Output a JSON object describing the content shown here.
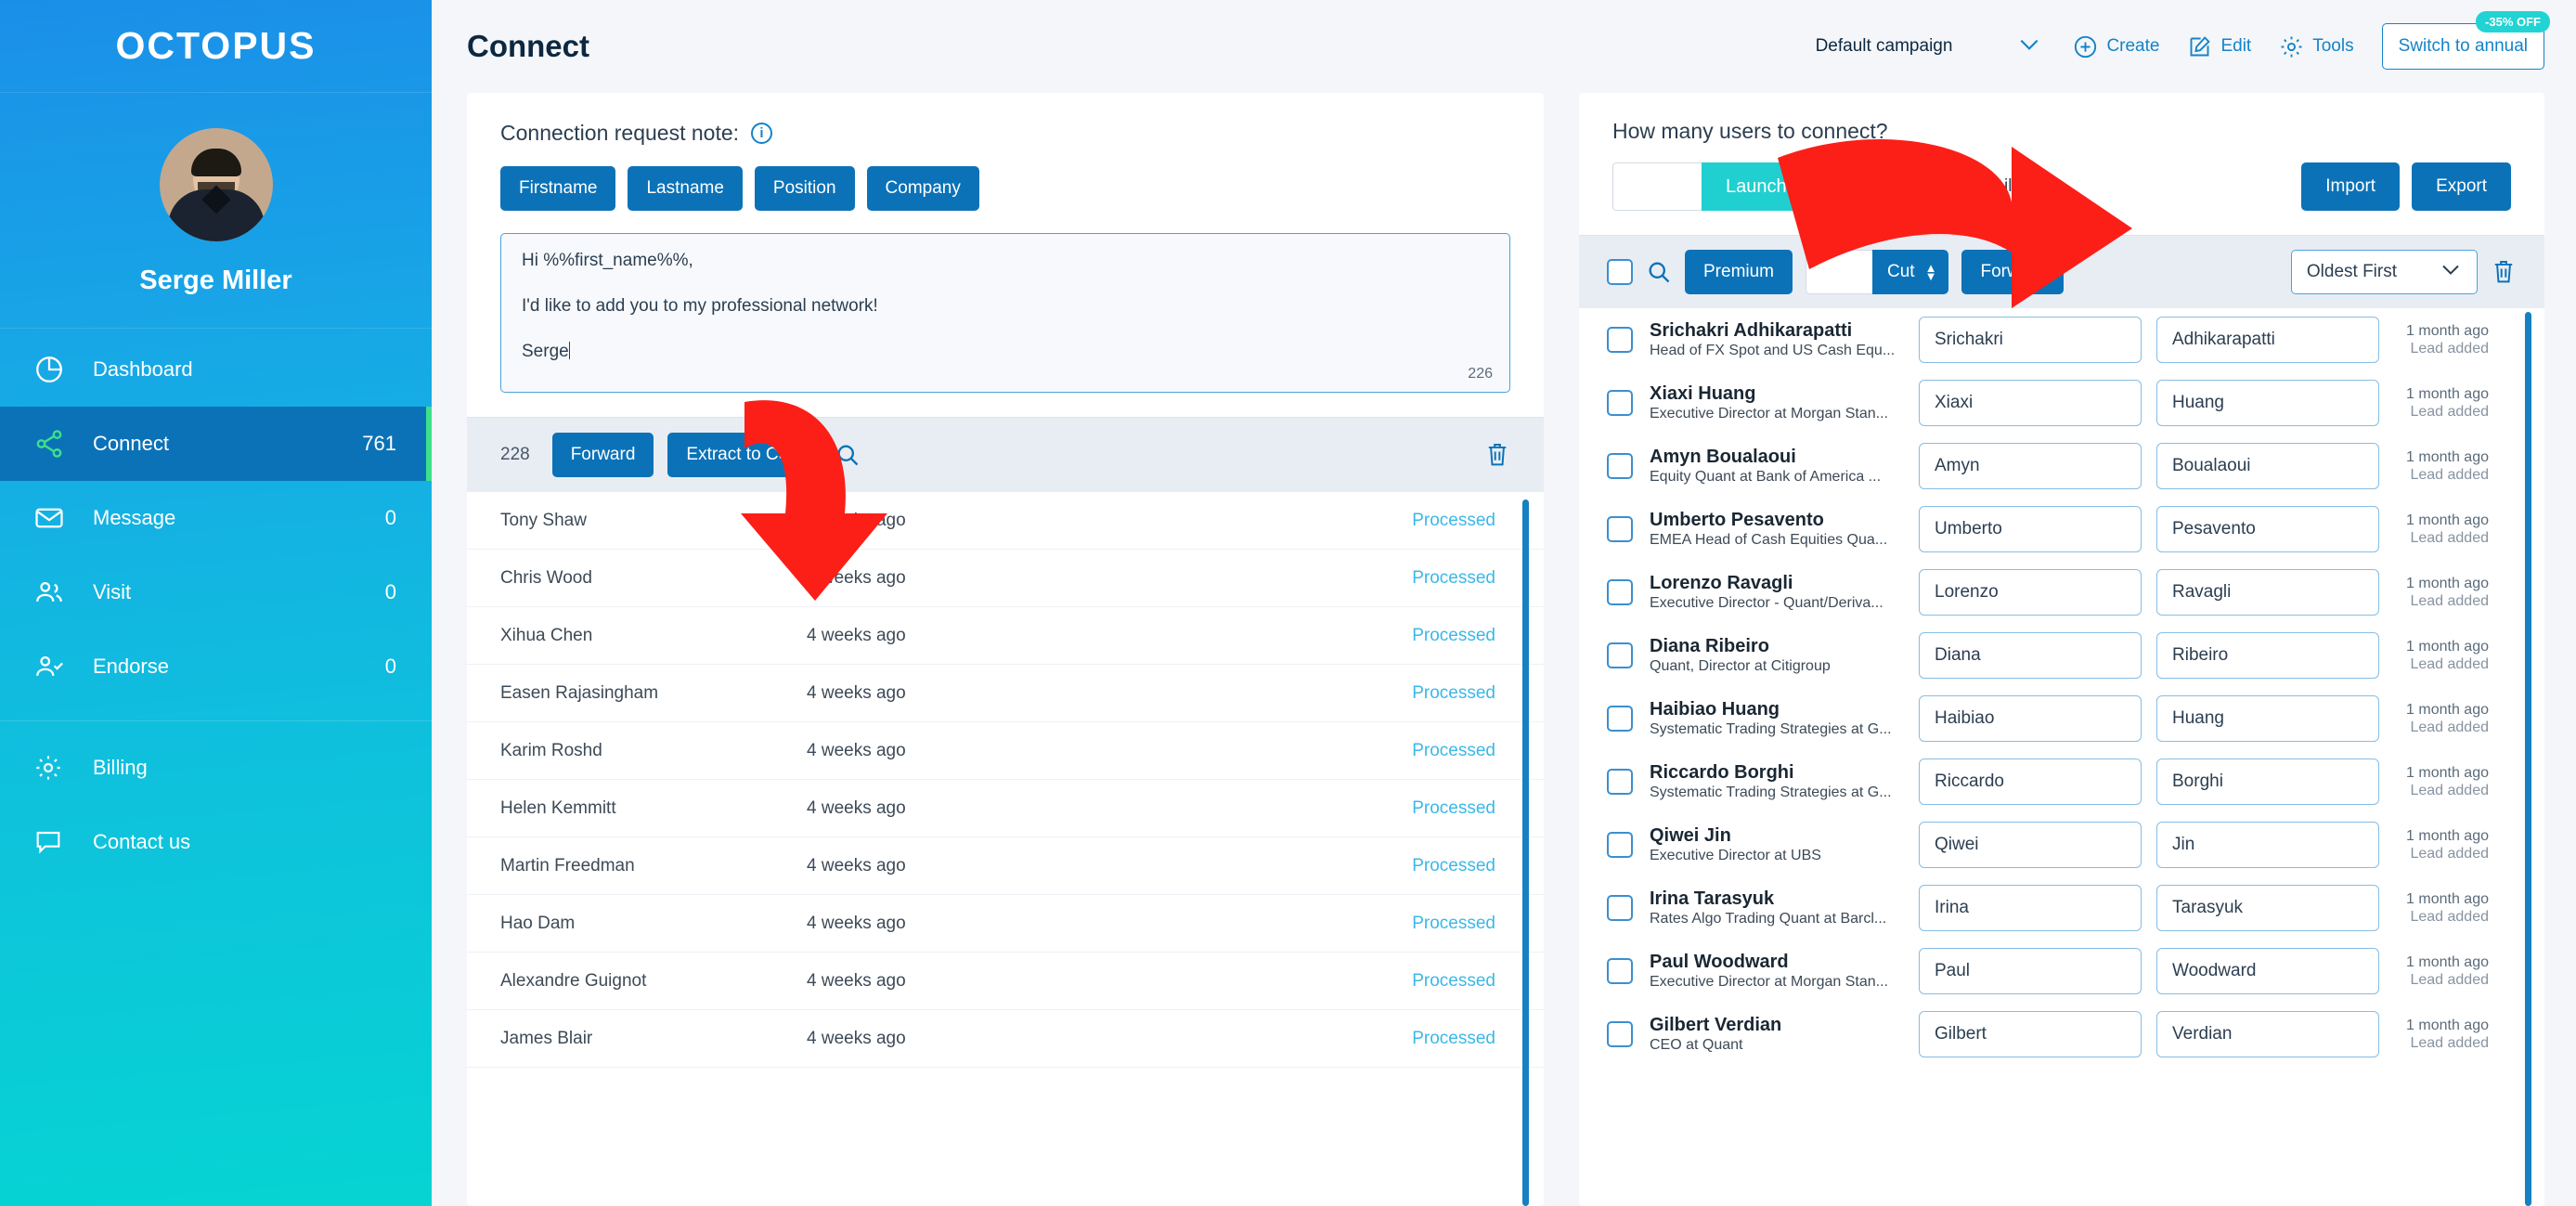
{
  "brand": {
    "logo_text": "OCTOPUS",
    "accent_blue": "#0b72b8",
    "accent_cyan": "#20cfcf",
    "green": "#3ee08a"
  },
  "sidebar": {
    "profile_name": "Serge Miller",
    "items": [
      {
        "label": "Dashboard",
        "count": "",
        "icon": "pie-chart-icon"
      },
      {
        "label": "Connect",
        "count": "761",
        "icon": "share-nodes-icon"
      },
      {
        "label": "Message",
        "count": "0",
        "icon": "envelope-icon"
      },
      {
        "label": "Visit",
        "count": "0",
        "icon": "users-icon"
      },
      {
        "label": "Endorse",
        "count": "0",
        "icon": "user-check-icon"
      }
    ],
    "bottom_items": [
      {
        "label": "Billing",
        "icon": "gear-icon"
      },
      {
        "label": "Contact us",
        "icon": "chat-bubble-icon"
      }
    ]
  },
  "header": {
    "title": "Connect",
    "campaign_value": "Default campaign",
    "create_label": "Create",
    "edit_label": "Edit",
    "tools_label": "Tools",
    "switch_annual_label": "Switch to annual",
    "discount_badge": "-35% OFF"
  },
  "note_panel": {
    "heading": "Connection request note:",
    "variables": [
      "Firstname",
      "Lastname",
      "Position",
      "Company"
    ],
    "message_lines": [
      "Hi %%first_name%%,",
      "I'd like to add you to my professional network!",
      "Serge"
    ],
    "char_count": "226"
  },
  "left_toolbar": {
    "count": "228",
    "forward_label": "Forward",
    "extract_label": "Extract to CSV"
  },
  "left_list": {
    "rows": [
      {
        "name": "Tony Shaw",
        "time": "4 weeks ago",
        "status": "Processed"
      },
      {
        "name": "Chris Wood",
        "time": "4 weeks ago",
        "status": "Processed"
      },
      {
        "name": "Xihua Chen",
        "time": "4 weeks ago",
        "status": "Processed"
      },
      {
        "name": "Easen Rajasingham",
        "time": "4 weeks ago",
        "status": "Processed"
      },
      {
        "name": "Karim Roshd",
        "time": "4 weeks ago",
        "status": "Processed"
      },
      {
        "name": "Helen Kemmitt",
        "time": "4 weeks ago",
        "status": "Processed"
      },
      {
        "name": "Martin Freedman",
        "time": "4 weeks ago",
        "status": "Processed"
      },
      {
        "name": "Hao Dam",
        "time": "4 weeks ago",
        "status": "Processed"
      },
      {
        "name": "Alexandre Guignot",
        "time": "4 weeks ago",
        "status": "Processed"
      },
      {
        "name": "James Blair",
        "time": "4 weeks ago",
        "status": "Processed"
      }
    ]
  },
  "right_panel": {
    "heading": "How many users to connect?",
    "launch_value": "",
    "launch_label": "Launch",
    "connect_by_email_label": "Connect by email",
    "import_label": "Import",
    "export_label": "Export",
    "premium_label": "Premium",
    "cut_value": "",
    "cut_label": "Cut",
    "forward_label": "Forward",
    "sort_value": "Oldest First",
    "rows": [
      {
        "name": "Srichakri Adhikarapatti",
        "title": "Head of FX Spot and US Cash Equ...",
        "first": "Srichakri",
        "last": "Adhikarapatti",
        "time": "1 month ago",
        "event": "Lead added"
      },
      {
        "name": "Xiaxi Huang",
        "title": "Executive Director at Morgan Stan...",
        "first": "Xiaxi",
        "last": "Huang",
        "time": "1 month ago",
        "event": "Lead added"
      },
      {
        "name": "Amyn Boualaoui",
        "title": "Equity Quant at Bank of America ...",
        "first": "Amyn",
        "last": "Boualaoui",
        "time": "1 month ago",
        "event": "Lead added"
      },
      {
        "name": "Umberto Pesavento",
        "title": "EMEA Head of Cash Equities Qua...",
        "first": "Umberto",
        "last": "Pesavento",
        "time": "1 month ago",
        "event": "Lead added"
      },
      {
        "name": "Lorenzo Ravagli",
        "title": "Executive Director - Quant/Deriva...",
        "first": "Lorenzo",
        "last": "Ravagli",
        "time": "1 month ago",
        "event": "Lead added"
      },
      {
        "name": "Diana Ribeiro",
        "title": "Quant, Director at Citigroup",
        "first": "Diana",
        "last": "Ribeiro",
        "time": "1 month ago",
        "event": "Lead added"
      },
      {
        "name": "Haibiao Huang",
        "title": "Systematic Trading Strategies at G...",
        "first": "Haibiao",
        "last": "Huang",
        "time": "1 month ago",
        "event": "Lead added"
      },
      {
        "name": "Riccardo Borghi",
        "title": "Systematic Trading Strategies at G...",
        "first": "Riccardo",
        "last": "Borghi",
        "time": "1 month ago",
        "event": "Lead added"
      },
      {
        "name": "Qiwei Jin",
        "title": "Executive Director at UBS",
        "first": "Qiwei",
        "last": "Jin",
        "time": "1 month ago",
        "event": "Lead added"
      },
      {
        "name": "Irina Tarasyuk",
        "title": "Rates Algo Trading Quant at Barcl...",
        "first": "Irina",
        "last": "Tarasyuk",
        "time": "1 month ago",
        "event": "Lead added"
      },
      {
        "name": "Paul Woodward",
        "title": "Executive Director at Morgan Stan...",
        "first": "Paul",
        "last": "Woodward",
        "time": "1 month ago",
        "event": "Lead added"
      },
      {
        "name": "Gilbert Verdian",
        "title": "CEO at Quant",
        "first": "Gilbert",
        "last": "Verdian",
        "time": "1 month ago",
        "event": "Lead added"
      }
    ]
  },
  "annotations": {
    "arrow_color": "#fb1f18"
  }
}
